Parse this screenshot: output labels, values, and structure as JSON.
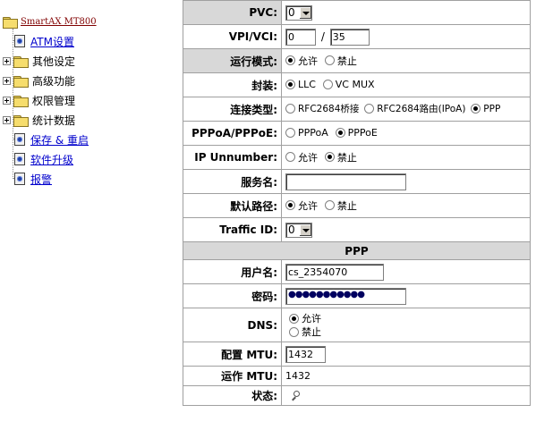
{
  "tree": {
    "root_label": "SmartAX MT800",
    "items": [
      {
        "label": "ATM设置",
        "type": "page",
        "link": true
      },
      {
        "label": "其他设定",
        "type": "folder",
        "link": false
      },
      {
        "label": "高级功能",
        "type": "folder",
        "link": false
      },
      {
        "label": "权限管理",
        "type": "folder",
        "link": false
      },
      {
        "label": "统计数据",
        "type": "folder",
        "link": false
      },
      {
        "label": "保存 & 重启",
        "type": "page",
        "link": true
      },
      {
        "label": "软件升级",
        "type": "page",
        "link": true
      },
      {
        "label": "报警",
        "type": "page",
        "link": true
      }
    ]
  },
  "form": {
    "pvc": {
      "label": "PVC:",
      "value": "0"
    },
    "vpivci": {
      "label": "VPI/VCI:",
      "vpi": "0",
      "sep": "/",
      "vci": "35"
    },
    "mode": {
      "label": "运行模式:",
      "opt1": "允许",
      "opt2": "禁止",
      "selected": "允许"
    },
    "encap": {
      "label": "封装:",
      "opt1": "LLC",
      "opt2": "VC MUX",
      "selected": "LLC"
    },
    "conn_type": {
      "label": "连接类型:",
      "opt1": "RFC2684桥接",
      "opt2": "RFC2684路由(IPoA)",
      "opt3": "PPP",
      "selected": "PPP"
    },
    "pppoa_pppoe": {
      "label": "PPPoA/PPPoE:",
      "opt1": "PPPoA",
      "opt2": "PPPoE",
      "selected": "PPPoE"
    },
    "ip_unnumber": {
      "label": "IP Unnumber:",
      "opt1": "允许",
      "opt2": "禁止",
      "selected": "禁止"
    },
    "service_name": {
      "label": "服务名:",
      "value": ""
    },
    "default_route": {
      "label": "默认路径:",
      "opt1": "允许",
      "opt2": "禁止",
      "selected": "允许"
    },
    "traffic_id": {
      "label": "Traffic ID:",
      "value": "0"
    },
    "ppp_section": "PPP",
    "username": {
      "label": "用户名:",
      "value": "cs_2354070"
    },
    "password": {
      "label": "密码:",
      "value": "●●●●●●●●●●●"
    },
    "dns": {
      "label": "DNS:",
      "opt1": "允许",
      "opt2": "禁止",
      "selected": "允许"
    },
    "config_mtu": {
      "label": "配置 MTU:",
      "value": "1432"
    },
    "running_mtu": {
      "label": "运作 MTU:",
      "value": "1432"
    },
    "status": {
      "label": "状态:",
      "icon": "magnifier-icon"
    }
  }
}
